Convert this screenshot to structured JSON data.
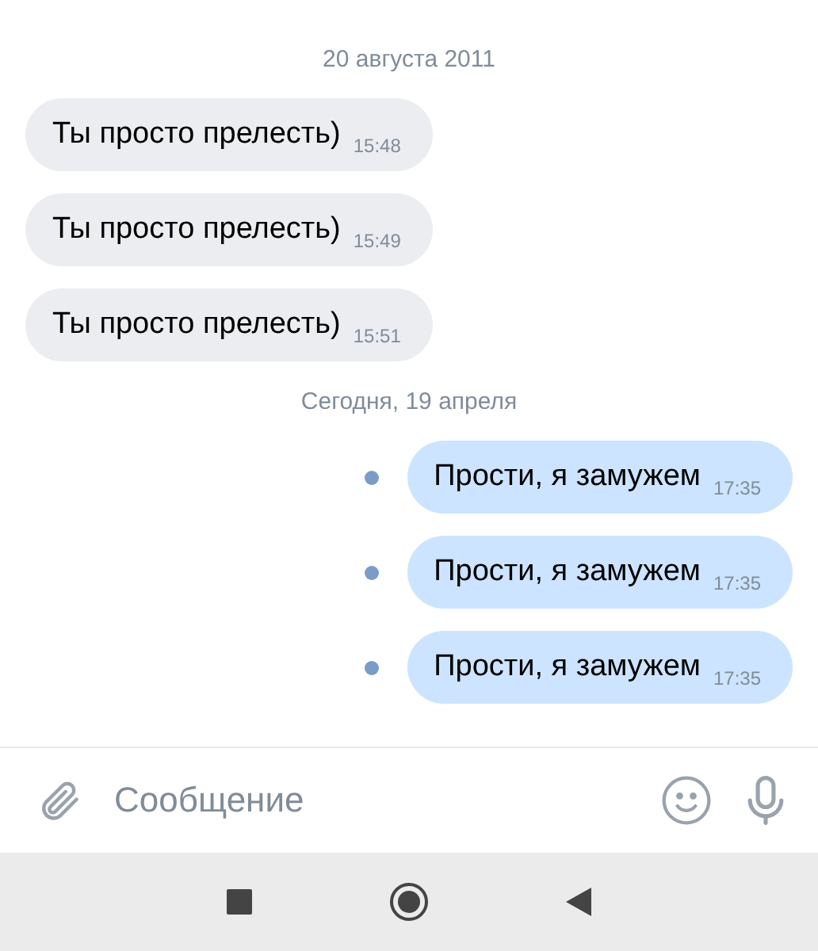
{
  "groups": [
    {
      "date": "20 августа 2011",
      "messages": [
        {
          "kind": "incoming",
          "text": "Ты просто прелесть)",
          "time": "15:48"
        },
        {
          "kind": "incoming",
          "text": "Ты просто прелесть)",
          "time": "15:49"
        },
        {
          "kind": "incoming",
          "text": "Ты просто прелесть)",
          "time": "15:51"
        }
      ]
    },
    {
      "date": "Сегодня, 19 апреля",
      "messages": [
        {
          "kind": "outgoing",
          "text": "Прости, я замужем",
          "time": "17:35",
          "unread": true
        },
        {
          "kind": "outgoing",
          "text": "Прости, я замужем",
          "time": "17:35",
          "unread": true
        },
        {
          "kind": "outgoing",
          "text": "Прости, я замужем",
          "time": "17:35",
          "unread": true
        }
      ]
    }
  ],
  "composer": {
    "placeholder": "Сообщение"
  }
}
